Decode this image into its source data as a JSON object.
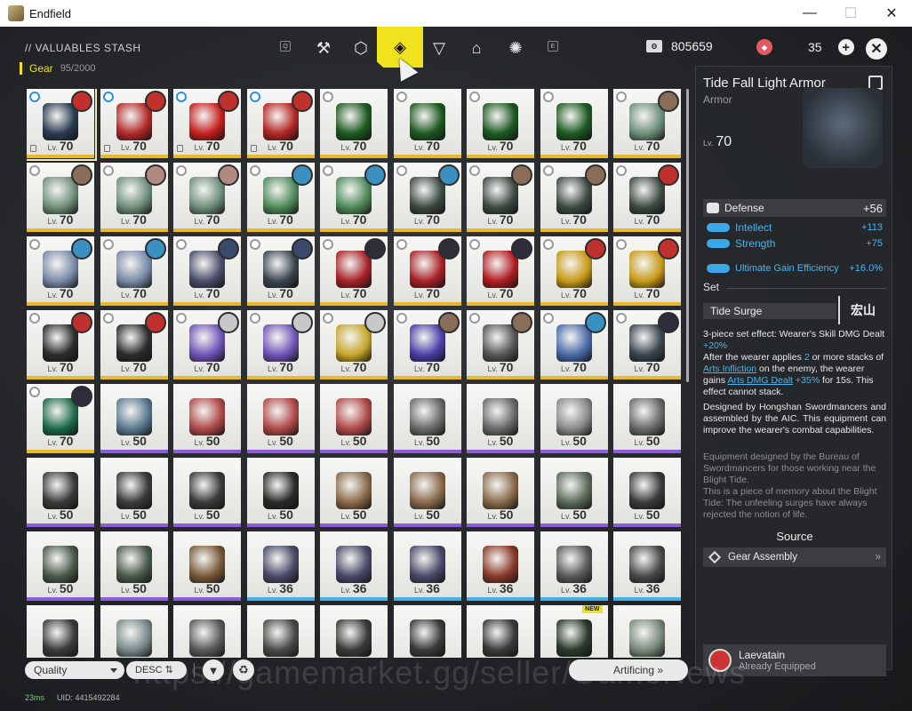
{
  "window": {
    "title": "Endfield",
    "minimize": "—",
    "maximize": "☐",
    "close": "✕"
  },
  "header": {
    "stash_title": "// VALUABLES STASH",
    "key_left": "Q",
    "key_right": "E",
    "tabs": [
      "⚒",
      "⬡",
      "◈",
      "▽",
      "⌂",
      "✺"
    ],
    "currency1": {
      "icon": "Θ",
      "value": "805659"
    },
    "currency2": {
      "icon": "◆",
      "value": "35"
    },
    "plus": "+",
    "close": "✕"
  },
  "category": {
    "name": "Gear",
    "count": "95/2000"
  },
  "grid": {
    "lv_prefix": "Lv.",
    "items": [
      {
        "lv": "70",
        "rarity": "gold",
        "color": "#2a3b52",
        "avatar": "#c0302c",
        "badge": "blue",
        "lock": true,
        "selected": true
      },
      {
        "lv": "70",
        "rarity": "gold",
        "color": "#b12a2a",
        "avatar": "#c0302c",
        "badge": "blue",
        "lock": true
      },
      {
        "lv": "70",
        "rarity": "gold",
        "color": "#c51f1f",
        "avatar": "#c0302c",
        "badge": "blue",
        "lock": true
      },
      {
        "lv": "70",
        "rarity": "gold",
        "color": "#b32525",
        "avatar": "#c0302c",
        "badge": "blue",
        "lock": true
      },
      {
        "lv": "70",
        "rarity": "gold",
        "color": "#1e5a22",
        "avatar": "",
        "badge": "grey"
      },
      {
        "lv": "70",
        "rarity": "gold",
        "color": "#1e5a22",
        "avatar": "",
        "badge": "grey"
      },
      {
        "lv": "70",
        "rarity": "gold",
        "color": "#1e5a22",
        "avatar": "",
        "badge": "grey"
      },
      {
        "lv": "70",
        "rarity": "gold",
        "color": "#1e5a22",
        "avatar": "",
        "badge": "grey"
      },
      {
        "lv": "70",
        "rarity": "gold",
        "color": "#6f8f7a",
        "avatar": "#8a6d58",
        "badge": "grey"
      },
      {
        "lv": "70",
        "rarity": "gold",
        "color": "#6f8f7a",
        "avatar": "#8a6d58",
        "badge": "grey"
      },
      {
        "lv": "70",
        "rarity": "gold",
        "color": "#6f8f7a",
        "avatar": "#b08a80",
        "badge": "grey"
      },
      {
        "lv": "70",
        "rarity": "gold",
        "color": "#6f8f7a",
        "avatar": "#b08a80",
        "badge": "grey"
      },
      {
        "lv": "70",
        "rarity": "gold",
        "color": "#4f8a5a",
        "avatar": "#3a90c0",
        "badge": "grey"
      },
      {
        "lv": "70",
        "rarity": "gold",
        "color": "#4f8a5a",
        "avatar": "#3a90c0",
        "badge": "grey"
      },
      {
        "lv": "70",
        "rarity": "gold",
        "color": "#3c4a40",
        "avatar": "#3a90c0",
        "badge": "grey"
      },
      {
        "lv": "70",
        "rarity": "gold",
        "color": "#3c4a40",
        "avatar": "#8a6d58",
        "badge": "grey"
      },
      {
        "lv": "70",
        "rarity": "gold",
        "color": "#3c4a40",
        "avatar": "#8a6d58",
        "badge": "grey"
      },
      {
        "lv": "70",
        "rarity": "gold",
        "color": "#3c4a40",
        "avatar": "#c0302c",
        "badge": "grey"
      },
      {
        "lv": "70",
        "rarity": "gold",
        "color": "#7a8aa8",
        "avatar": "#3a90c0",
        "badge": "grey"
      },
      {
        "lv": "70",
        "rarity": "gold",
        "color": "#7a8aa8",
        "avatar": "#3a90c0",
        "badge": "grey"
      },
      {
        "lv": "70",
        "rarity": "gold",
        "color": "#4a4e6a",
        "avatar": "#3a4a6a",
        "badge": "grey"
      },
      {
        "lv": "70",
        "rarity": "gold",
        "color": "#3a4550",
        "avatar": "#3a4a6a",
        "badge": "grey"
      },
      {
        "lv": "70",
        "rarity": "gold",
        "color": "#a82228",
        "avatar": "#2e2e3a",
        "badge": "grey"
      },
      {
        "lv": "70",
        "rarity": "gold",
        "color": "#a82228",
        "avatar": "#2e2e3a",
        "badge": "grey"
      },
      {
        "lv": "70",
        "rarity": "gold",
        "color": "#b01c22",
        "avatar": "#2e2e3a",
        "badge": "grey"
      },
      {
        "lv": "70",
        "rarity": "gold",
        "color": "#c79a18",
        "avatar": "#c0302c",
        "badge": "grey"
      },
      {
        "lv": "70",
        "rarity": "gold",
        "color": "#c79a18",
        "avatar": "#c0302c",
        "badge": "grey"
      },
      {
        "lv": "70",
        "rarity": "gold",
        "color": "#2c2c2c",
        "avatar": "#c0302c",
        "badge": "grey"
      },
      {
        "lv": "70",
        "rarity": "gold",
        "color": "#2c2c2c",
        "avatar": "#c0302c",
        "badge": "grey"
      },
      {
        "lv": "70",
        "rarity": "gold",
        "color": "#7055b8",
        "avatar": "#c8c8c8",
        "badge": "grey"
      },
      {
        "lv": "70",
        "rarity": "gold",
        "color": "#7055b8",
        "avatar": "#c8c8c8",
        "badge": "grey"
      },
      {
        "lv": "70",
        "rarity": "gold",
        "color": "#c6a52a",
        "avatar": "#c8c8c8",
        "badge": "grey"
      },
      {
        "lv": "70",
        "rarity": "gold",
        "color": "#4a3fa8",
        "avatar": "#8a6d58",
        "badge": "grey"
      },
      {
        "lv": "70",
        "rarity": "gold",
        "color": "#555555",
        "avatar": "#8a6d58",
        "badge": "grey"
      },
      {
        "lv": "70",
        "rarity": "gold",
        "color": "#4a6aa8",
        "avatar": "#3a90c0",
        "badge": "grey"
      },
      {
        "lv": "70",
        "rarity": "gold",
        "color": "#3a4550",
        "avatar": "#2e2e3a",
        "badge": "grey"
      },
      {
        "lv": "70",
        "rarity": "gold",
        "color": "#1e6b4a",
        "avatar": "#2e2e3a",
        "badge": "grey"
      },
      {
        "lv": "50",
        "rarity": "purple",
        "color": "#5a7a90",
        "avatar": "",
        "badge": ""
      },
      {
        "lv": "50",
        "rarity": "purple",
        "color": "#b04a4a",
        "avatar": "",
        "badge": ""
      },
      {
        "lv": "50",
        "rarity": "purple",
        "color": "#b04a4a",
        "avatar": "",
        "badge": ""
      },
      {
        "lv": "50",
        "rarity": "purple",
        "color": "#b04a4a",
        "avatar": "",
        "badge": ""
      },
      {
        "lv": "50",
        "rarity": "purple",
        "color": "#6a6a6a",
        "avatar": "",
        "badge": ""
      },
      {
        "lv": "50",
        "rarity": "purple",
        "color": "#6a6a6a",
        "avatar": "",
        "badge": ""
      },
      {
        "lv": "50",
        "rarity": "purple",
        "color": "#8a8a8a",
        "avatar": "",
        "badge": ""
      },
      {
        "lv": "50",
        "rarity": "purple",
        "color": "#6a6a6a",
        "avatar": "",
        "badge": ""
      },
      {
        "lv": "50",
        "rarity": "purple",
        "color": "#3a3a3a",
        "avatar": "",
        "badge": ""
      },
      {
        "lv": "50",
        "rarity": "purple",
        "color": "#3a3a3a",
        "avatar": "",
        "badge": ""
      },
      {
        "lv": "50",
        "rarity": "purple",
        "color": "#3a3a3a",
        "avatar": "",
        "badge": ""
      },
      {
        "lv": "50",
        "rarity": "purple",
        "color": "#2a2a2a",
        "avatar": "",
        "badge": ""
      },
      {
        "lv": "50",
        "rarity": "purple",
        "color": "#8a6a4a",
        "avatar": "",
        "badge": ""
      },
      {
        "lv": "50",
        "rarity": "purple",
        "color": "#8a6a4a",
        "avatar": "",
        "badge": ""
      },
      {
        "lv": "50",
        "rarity": "purple",
        "color": "#8a6a4a",
        "avatar": "",
        "badge": ""
      },
      {
        "lv": "50",
        "rarity": "purple",
        "color": "#5a6a5a",
        "avatar": "",
        "badge": ""
      },
      {
        "lv": "50",
        "rarity": "purple",
        "color": "#3a3a3a",
        "avatar": "",
        "badge": ""
      },
      {
        "lv": "50",
        "rarity": "purple",
        "color": "#4a5a4a",
        "avatar": "",
        "badge": ""
      },
      {
        "lv": "50",
        "rarity": "purple",
        "color": "#4a5a4a",
        "avatar": "",
        "badge": ""
      },
      {
        "lv": "50",
        "rarity": "purple",
        "color": "#7a5a3a",
        "avatar": "",
        "badge": ""
      },
      {
        "lv": "36",
        "rarity": "blue",
        "color": "#4a4a6a",
        "avatar": "",
        "badge": ""
      },
      {
        "lv": "36",
        "rarity": "blue",
        "color": "#4a4a6a",
        "avatar": "",
        "badge": ""
      },
      {
        "lv": "36",
        "rarity": "blue",
        "color": "#4a4a6a",
        "avatar": "",
        "badge": ""
      },
      {
        "lv": "36",
        "rarity": "blue",
        "color": "#8a3a2a",
        "avatar": "",
        "badge": ""
      },
      {
        "lv": "36",
        "rarity": "blue",
        "color": "#5a5a5a",
        "avatar": "",
        "badge": ""
      },
      {
        "lv": "36",
        "rarity": "blue",
        "color": "#4a4a4a",
        "avatar": "",
        "badge": ""
      },
      {
        "lv": "",
        "rarity": "blue",
        "color": "#3a3a3a",
        "avatar": "",
        "badge": ""
      },
      {
        "lv": "",
        "rarity": "blue",
        "color": "#7a8a8a",
        "avatar": "",
        "badge": ""
      },
      {
        "lv": "",
        "rarity": "blue",
        "color": "#5a5a5a",
        "avatar": "",
        "badge": ""
      },
      {
        "lv": "",
        "rarity": "blue",
        "color": "#4a4a4a",
        "avatar": "",
        "badge": ""
      },
      {
        "lv": "",
        "rarity": "blue",
        "color": "#3a3a3a",
        "avatar": "",
        "badge": ""
      },
      {
        "lv": "",
        "rarity": "blue",
        "color": "#3a3a3a",
        "avatar": "",
        "badge": ""
      },
      {
        "lv": "",
        "rarity": "blue",
        "color": "#3a3a3a",
        "avatar": "",
        "badge": ""
      },
      {
        "lv": "",
        "rarity": "blue",
        "color": "#2a3a2a",
        "avatar": "",
        "badge": "",
        "new": "NEW"
      },
      {
        "lv": "",
        "rarity": "blue",
        "color": "#7a8a7a",
        "avatar": "",
        "badge": ""
      }
    ]
  },
  "details": {
    "name": "Tide Fall Light Armor",
    "type": "Armor",
    "lv_prefix": "Lv.",
    "level": "70",
    "main_stat": {
      "name": "Defense",
      "value": "+56"
    },
    "stats": [
      {
        "name": "Intellect",
        "value": "+113"
      },
      {
        "name": "Strength",
        "value": "+75"
      },
      {
        "name": "Ultimate Gain Efficiency",
        "value": "+16.0%"
      }
    ],
    "set_label": "Set",
    "set_name": "Tide Surge",
    "set_logo": "宏山",
    "effect": {
      "p1": "3-piece set effect: Wearer's Skill DMG Dealt ",
      "p1_hl": "+20%",
      "p2": "After the wearer applies ",
      "p2_hl": "2",
      "p3": " or more stacks of ",
      "p3_link": "Arts Infliction",
      "p4": " on the enemy, the wearer gains ",
      "p4_link": "Arts DMG Dealt",
      "p4_hl": " +35%",
      "p5": " for 15s. This effect cannot stack."
    },
    "desc1": "Designed by Hongshan Swordmancers and assembled by the AIC. This equipment can improve the wearer's combat capabilities.",
    "desc2": "Equipment designed by the Bureau of Swordmancers for those working near the Blight Tide.",
    "desc3": "This is a piece of memory about the Blight Tide: The unfeeling surges have always rejected the notion of life.",
    "source_title": "Source",
    "source_item": "Gear Assembly",
    "source_chev": "»",
    "equipped_name": "Laevatain",
    "equipped_status": "Already Equipped"
  },
  "footer": {
    "sort": "Quality",
    "order": "DESC ⇅",
    "filter": "▼",
    "recycle": "♻",
    "watermark": "https://gamemarket.gg/seller/GameNews",
    "artificing": "Artificing »",
    "ping": "23ms",
    "uid": "UID: 4415492284"
  },
  "colors": {
    "accent": "#f1e21e",
    "gold": "#e8b92b",
    "purple": "#8d5cd8",
    "blue": "#43b1e4",
    "stat_blue": "#4bb4ec"
  }
}
